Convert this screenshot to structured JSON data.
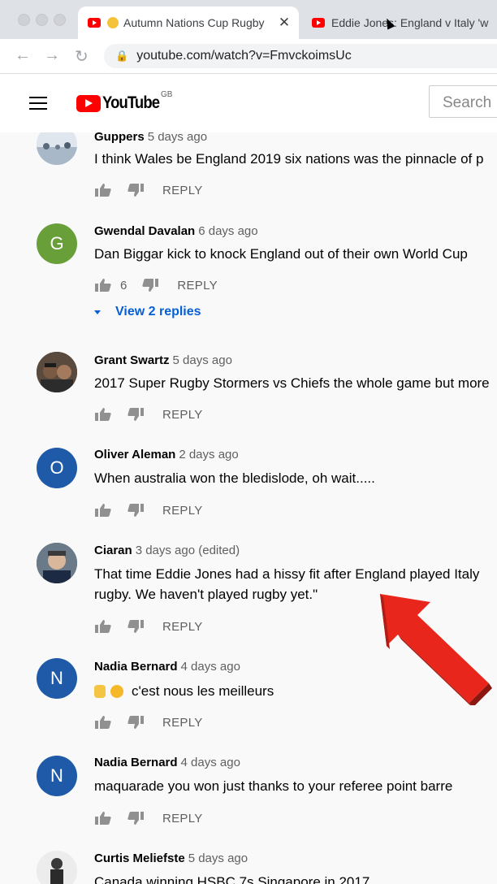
{
  "browser": {
    "tabs": [
      {
        "title": "Autumn Nations Cup Rugby",
        "close": "✕"
      },
      {
        "title": "Eddie Jones: England v Italy 'w"
      }
    ],
    "url": "youtube.com/watch?v=FmvckoimsUc"
  },
  "header": {
    "logo_text": "YouTube",
    "region": "GB",
    "search_placeholder": "Search"
  },
  "colors": {
    "accent_red": "#ff0000",
    "link_blue": "#065fd4",
    "avatar_green": "#689f38",
    "avatar_blue": "#1e5aa8",
    "arrow_red": "#e8261c"
  },
  "comments": [
    {
      "author": "Guppers",
      "time": "5 days ago",
      "text": "I think Wales be England 2019 six nations was the pinnacle of p",
      "likes": "",
      "reply": "REPLY",
      "avatar": "photo"
    },
    {
      "author": "Gwendal Davalan",
      "time": "6 days ago",
      "text": "Dan Biggar kick to knock England out of their own World Cup",
      "likes": "6",
      "reply": "REPLY",
      "avatar_letter": "G",
      "view_replies": "View 2 replies"
    },
    {
      "author": "Grant Swartz",
      "time": "5 days ago",
      "text": "2017 Super Rugby Stormers vs Chiefs the whole game but more",
      "likes": "",
      "reply": "REPLY",
      "avatar": "photo"
    },
    {
      "author": "Oliver Aleman",
      "time": "2 days ago",
      "text": "When australia won the bledislode, oh wait.....",
      "likes": "",
      "reply": "REPLY",
      "avatar_letter": "O"
    },
    {
      "author": "Ciaran",
      "time": "3 days ago (edited)",
      "text": "That time Eddie Jones had a hissy fit after England played Italy",
      "text2": "rugby. We haven't played rugby yet.\"",
      "likes": "",
      "reply": "REPLY",
      "avatar": "photo"
    },
    {
      "author": "Nadia Bernard",
      "time": "4 days ago",
      "text": "c'est nous les meilleurs",
      "likes": "",
      "reply": "REPLY",
      "avatar_letter": "N"
    },
    {
      "author": "Nadia Bernard",
      "time": "4 days ago",
      "text": "maquarade you won just thanks to your referee point barre",
      "likes": "",
      "reply": "REPLY",
      "avatar_letter": "N"
    },
    {
      "author": "Curtis Meliefste",
      "time": "5 days ago",
      "text": "Canada winning HSBC 7s Singapore in 2017",
      "avatar": "photo"
    }
  ]
}
